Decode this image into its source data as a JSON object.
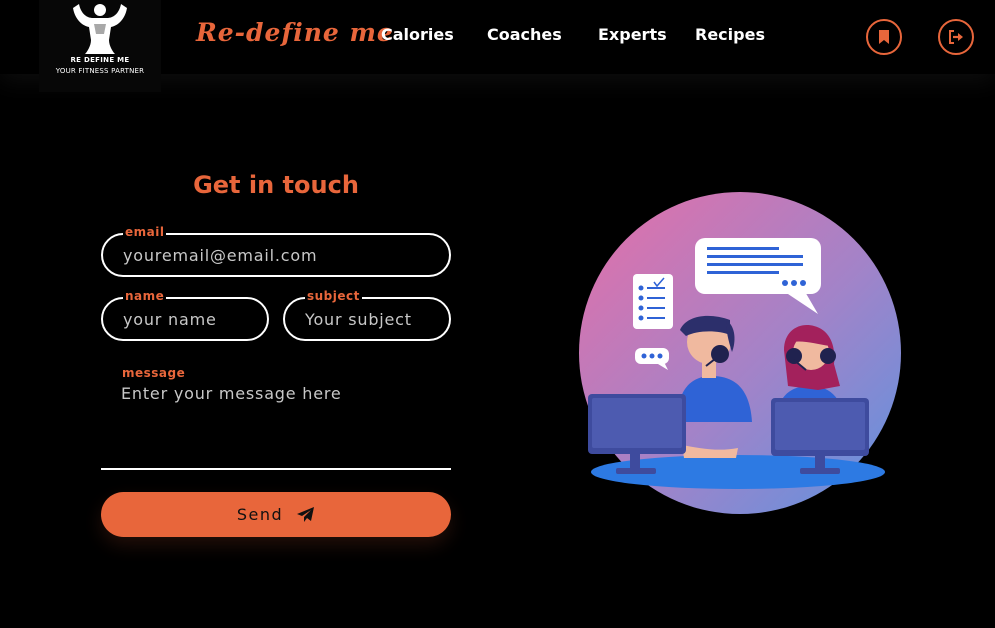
{
  "logo": {
    "line1": "RE DEFINE ME",
    "line2": "YOUR FITNESS PARTNER"
  },
  "brand": "Re-define me",
  "nav": [
    "Calories",
    "Coaches",
    "Experts",
    "Recipes"
  ],
  "nav_icons": [
    "bookmark-icon",
    "logout-icon"
  ],
  "contact": {
    "title": "Get in touch",
    "email_label": "email",
    "email_placeholder": "youremail@email.com",
    "name_label": "name",
    "name_placeholder": "your name",
    "subject_label": "subject",
    "subject_placeholder": "Your subject",
    "message_label": "message",
    "message_placeholder": "Enter your message here",
    "send_label": "Send"
  },
  "colors": {
    "accent": "#e8663b",
    "background": "#000000"
  }
}
